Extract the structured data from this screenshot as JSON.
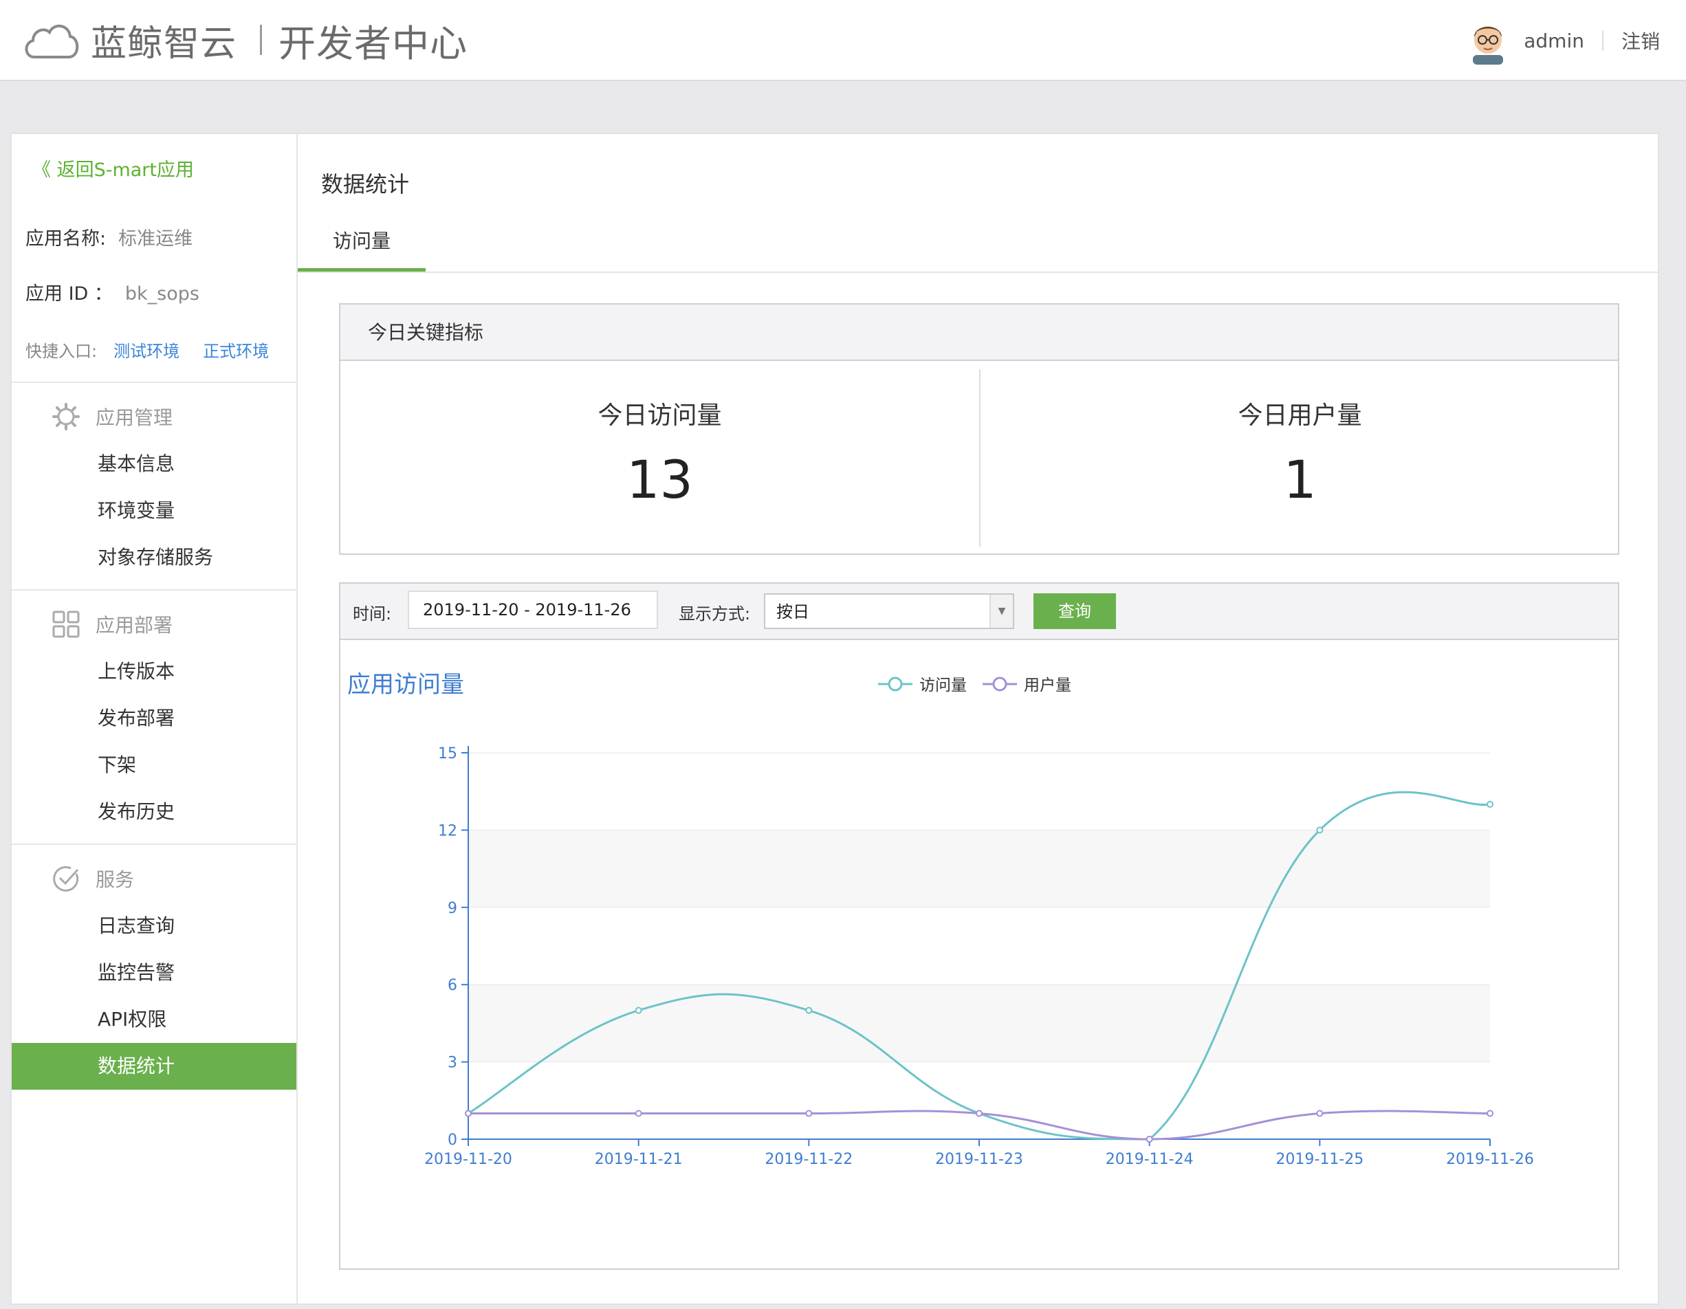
{
  "header": {
    "brand": "蓝鲸智云",
    "subtitle": "开发者中心",
    "username": "admin",
    "logout": "注销"
  },
  "sidebar": {
    "back": "《 返回S-mart应用",
    "app_name_label": "应用名称:",
    "app_name": "标准运维",
    "app_id_label": "应用 ID ：",
    "app_id": "bk_sops",
    "quick_label": "快捷入口:",
    "quick_links": [
      "测试环境",
      "正式环境"
    ],
    "groups": [
      {
        "title": "应用管理",
        "icon": "gear-icon",
        "items": [
          "基本信息",
          "环境变量",
          "对象存储服务"
        ]
      },
      {
        "title": "应用部署",
        "icon": "grid-icon",
        "items": [
          "上传版本",
          "发布部署",
          "下架",
          "发布历史"
        ]
      },
      {
        "title": "服务",
        "icon": "check-circle-icon",
        "items": [
          "日志查询",
          "监控告警",
          "API权限",
          "数据统计"
        ]
      }
    ],
    "active_item": "数据统计"
  },
  "content": {
    "title": "数据统计",
    "tabs": [
      "访问量"
    ],
    "kpi": {
      "header": "今日关键指标",
      "visits_label": "今日访问量",
      "visits_value": "13",
      "users_label": "今日用户量",
      "users_value": "1"
    },
    "filter": {
      "time_label": "时间:",
      "date_range": "2019-11-20 - 2019-11-26",
      "display_label": "显示方式:",
      "display_value": "按日",
      "query_button": "查询"
    }
  },
  "chart_data": {
    "type": "line",
    "title": "应用访问量",
    "categories": [
      "2019-11-20",
      "2019-11-21",
      "2019-11-22",
      "2019-11-23",
      "2019-11-24",
      "2019-11-25",
      "2019-11-26"
    ],
    "series": [
      {
        "name": "访问量",
        "values": [
          1,
          5,
          5,
          1,
          0,
          12,
          13
        ],
        "color": "#6cc3c7"
      },
      {
        "name": "用户量",
        "values": [
          1,
          1,
          1,
          1,
          0,
          1,
          1
        ],
        "color": "#a590d6"
      }
    ],
    "ylim": [
      0,
      15
    ],
    "yticks": [
      0,
      3,
      6,
      9,
      12,
      15
    ],
    "smooth": true,
    "legend_position": "top-center",
    "axis_color": "#3f7dd1",
    "band_color": "#f7f7f7"
  }
}
